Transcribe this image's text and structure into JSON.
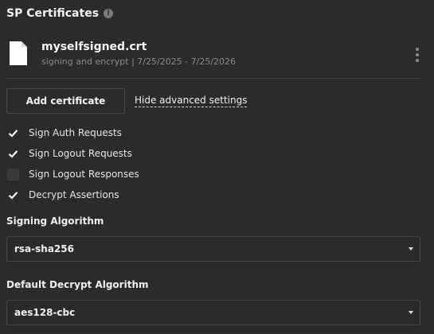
{
  "section": {
    "title": "SP Certificates",
    "info_icon": "info-icon"
  },
  "certificate": {
    "name": "myselfsigned.crt",
    "usage": "signing and encrypt",
    "separator": "|",
    "validity": "7/25/2025 - 7/25/2026",
    "file_icon": "file-icon",
    "menu_icon": "kebab-menu-icon"
  },
  "actions": {
    "add_certificate": "Add certificate",
    "advanced_toggle": "Hide advanced settings"
  },
  "options": [
    {
      "label": "Sign Auth Requests",
      "checked": true
    },
    {
      "label": "Sign Logout Requests",
      "checked": true
    },
    {
      "label": "Sign Logout Responses",
      "checked": false
    },
    {
      "label": "Decrypt Assertions",
      "checked": true
    }
  ],
  "signing_algorithm": {
    "label": "Signing Algorithm",
    "value": "rsa-sha256"
  },
  "decrypt_algorithm": {
    "label": "Default Decrypt Algorithm",
    "value": "aes128-cbc"
  },
  "colors": {
    "background": "#2b2b2b",
    "text": "#e6e6e6",
    "muted": "#8c8c8c"
  }
}
